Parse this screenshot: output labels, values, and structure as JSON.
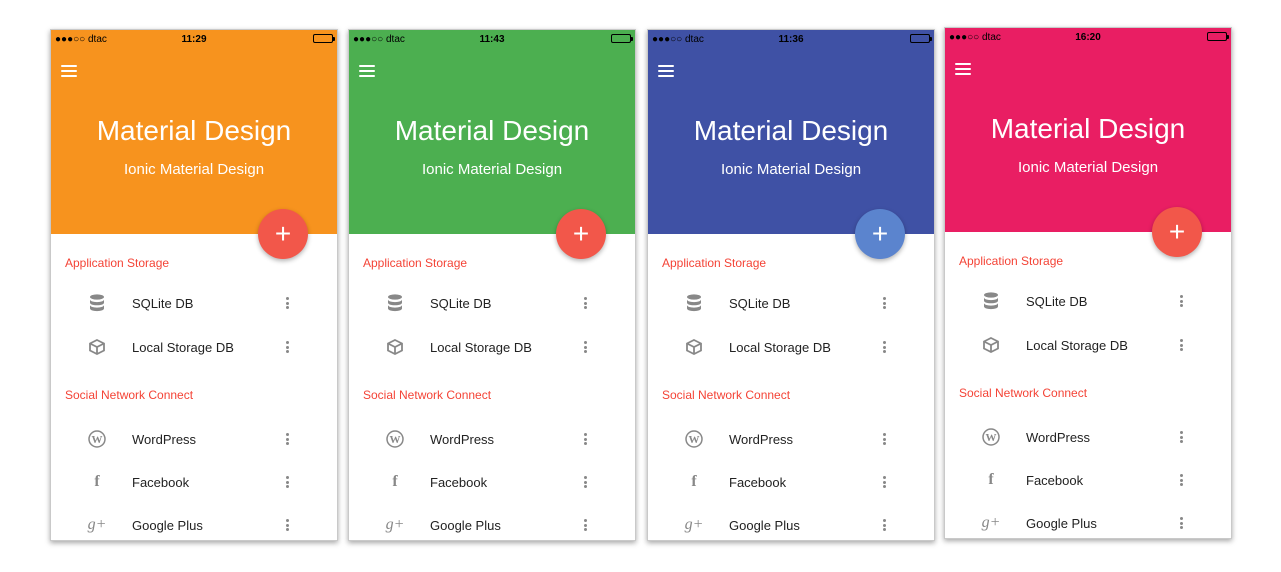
{
  "screens": [
    {
      "status": {
        "carrier": "●●●○○ dtac",
        "time": "11:29"
      },
      "title": "Material Design",
      "subtitle": "Ionic Material Design",
      "header_color": "#F7931E",
      "fab_color": "#F2574A",
      "fab_icon": "+",
      "sections": [
        "Application Storage",
        "Social Network Connect"
      ],
      "items": [
        "SQLite DB",
        "Local Storage DB",
        "WordPress",
        "Facebook",
        "Google Plus"
      ]
    },
    {
      "status": {
        "carrier": "●●●○○ dtac",
        "time": "11:43"
      },
      "title": "Material Design",
      "subtitle": "Ionic Material Design",
      "header_color": "#4CAF50",
      "fab_color": "#F2574A",
      "fab_icon": "+",
      "sections": [
        "Application Storage",
        "Social Network Connect"
      ],
      "items": [
        "SQLite DB",
        "Local Storage DB",
        "WordPress",
        "Facebook",
        "Google Plus"
      ]
    },
    {
      "status": {
        "carrier": "●●●○○ dtac",
        "time": "11:36"
      },
      "title": "Material Design",
      "subtitle": "Ionic Material Design",
      "header_color": "#3F51A5",
      "fab_color": "#5B84CE",
      "fab_icon": "+",
      "sections": [
        "Application Storage",
        "Social Network Connect"
      ],
      "items": [
        "SQLite DB",
        "Local Storage DB",
        "WordPress",
        "Facebook",
        "Google Plus"
      ]
    },
    {
      "status": {
        "carrier": "●●●○○ dtac",
        "time": "16:20"
      },
      "title": "Material Design",
      "subtitle": "Ionic Material Design",
      "header_color": "#E91E63",
      "fab_color": "#F2574A",
      "fab_icon": "+",
      "sections": [
        "Application Storage",
        "Social Network Connect"
      ],
      "items": [
        "SQLite DB",
        "Local Storage DB",
        "WordPress",
        "Facebook",
        "Google Plus"
      ]
    }
  ],
  "icons": [
    "database-icon",
    "cube-icon",
    "wordpress-icon",
    "facebook-icon",
    "google-plus-icon"
  ],
  "colors": {
    "section_text": "#F44336",
    "icon_grey": "#888888"
  }
}
